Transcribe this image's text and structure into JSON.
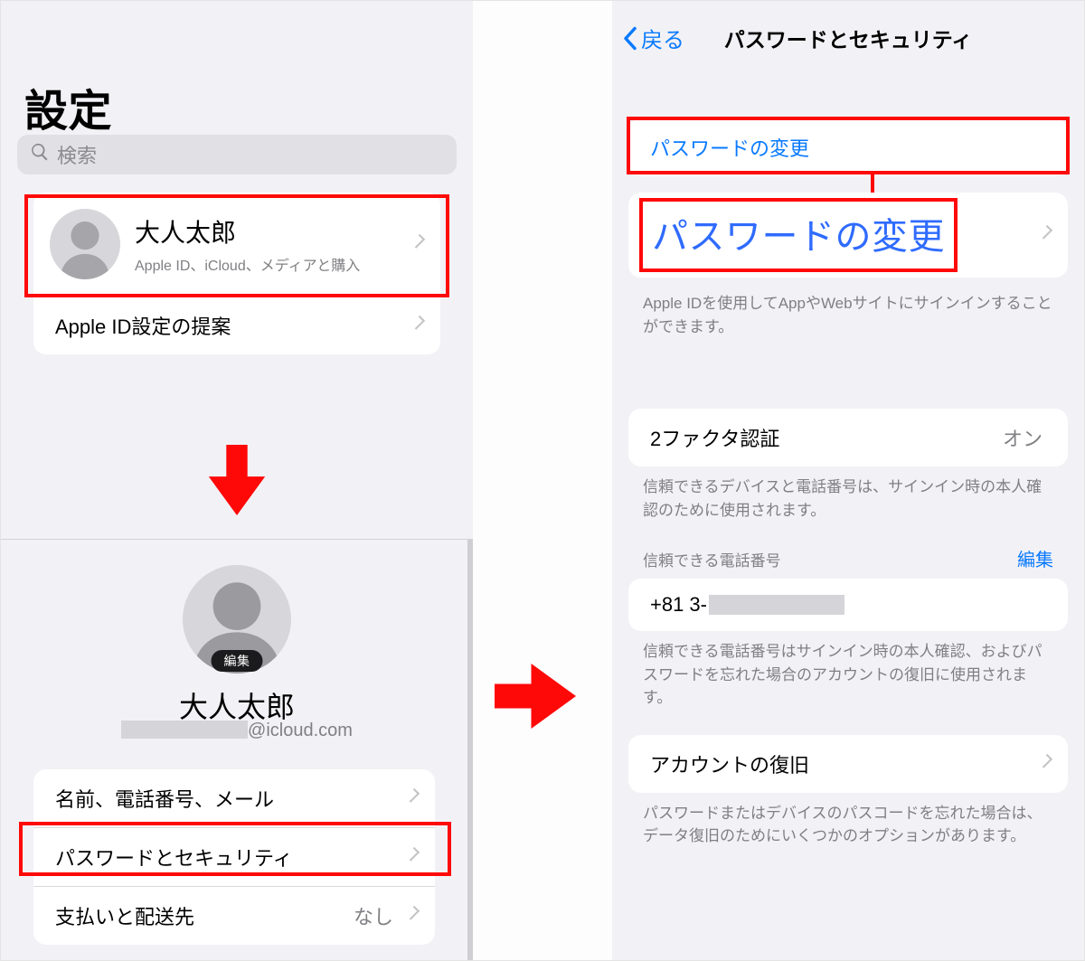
{
  "left": {
    "screen1": {
      "title": "設定",
      "search_placeholder": "検索",
      "profile": {
        "name": "大人太郎",
        "subtitle": "Apple ID、iCloud、メディアと購入"
      },
      "suggestion_label": "Apple ID設定の提案"
    },
    "screen2": {
      "edit_pill": "編集",
      "name": "大人太郎",
      "email_suffix": "@icloud.com",
      "rows": {
        "name_phone_mail": "名前、電話番号、メール",
        "password_security": "パスワードとセキュリティ",
        "payment_shipping": "支払いと配送先",
        "payment_shipping_value": "なし"
      }
    }
  },
  "right": {
    "back_label": "戻る",
    "title": "パスワードとセキュリティ",
    "change_password": "パスワードの変更",
    "change_password_big": "パスワードの変更",
    "signin_footnote": "Apple IDを使用してAppやWebサイトにサインインすることができます。",
    "twofactor_label": "2ファクタ認証",
    "twofactor_value": "オン",
    "twofactor_footnote": "信頼できるデバイスと電話番号は、サインイン時の本人確認のために使用されます。",
    "trusted_header": "信頼できる電話番号",
    "edit_label": "編集",
    "phone_prefix": "+81 3-",
    "phone_footnote": "信頼できる電話番号はサインイン時の本人確認、およびパスワードを忘れた場合のアカウントの復旧に使用されます。",
    "recovery_label": "アカウントの復旧",
    "recovery_footnote": "パスワードまたはデバイスのパスコードを忘れた場合は、データ復旧のためにいくつかのオプションがあります。"
  }
}
